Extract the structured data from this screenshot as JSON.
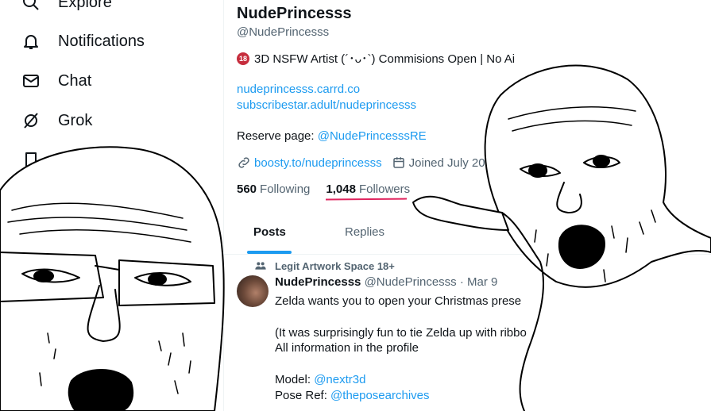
{
  "sidebar": {
    "items": [
      {
        "label": "Explore",
        "icon": "search-icon"
      },
      {
        "label": "Notifications",
        "icon": "bell-icon"
      },
      {
        "label": "Chat",
        "icon": "mail-icon"
      },
      {
        "label": "Grok",
        "icon": "grok-icon"
      },
      {
        "label": "",
        "icon": "bookmark-icon"
      }
    ]
  },
  "profile": {
    "display_name": "NudePrincesss",
    "handle": "@NudePrincesss",
    "bio_badge": "18",
    "bio": "3D NSFW Artist (´･ᴗ･`) Commisions Open | No Ai",
    "link1": "nudeprincesss.carrd.co",
    "link2": "subscribestar.adult/nudeprincesss",
    "reserve_label": "Reserve page: ",
    "reserve_link": "@NudePrincesssRE",
    "website": "boosty.to/nudeprincesss",
    "joined": "Joined July 20",
    "following_count": "560",
    "following_label": "Following",
    "followers_count": "1,048",
    "followers_label": "Followers"
  },
  "tabs": [
    {
      "label": "Posts",
      "active": true
    },
    {
      "label": "Replies",
      "active": false
    }
  ],
  "post": {
    "community": "Legit Artwork Space 18+",
    "author": "NudePrincesss",
    "handle_date": "@NudePrincesss · Mar 9",
    "line1": "Zelda wants you to open your Christmas prese",
    "line2": "(It was surprisingly fun to tie Zelda up with ribbo",
    "line3": "All information in the profile",
    "model_label": "Model: ",
    "model_link": "@nextr3d",
    "pose_label": "Pose Ref: ",
    "pose_link": "@theposearchives"
  },
  "colors": {
    "accent": "#1d9bf0",
    "underline": "#e0245e",
    "muted": "#536471"
  }
}
